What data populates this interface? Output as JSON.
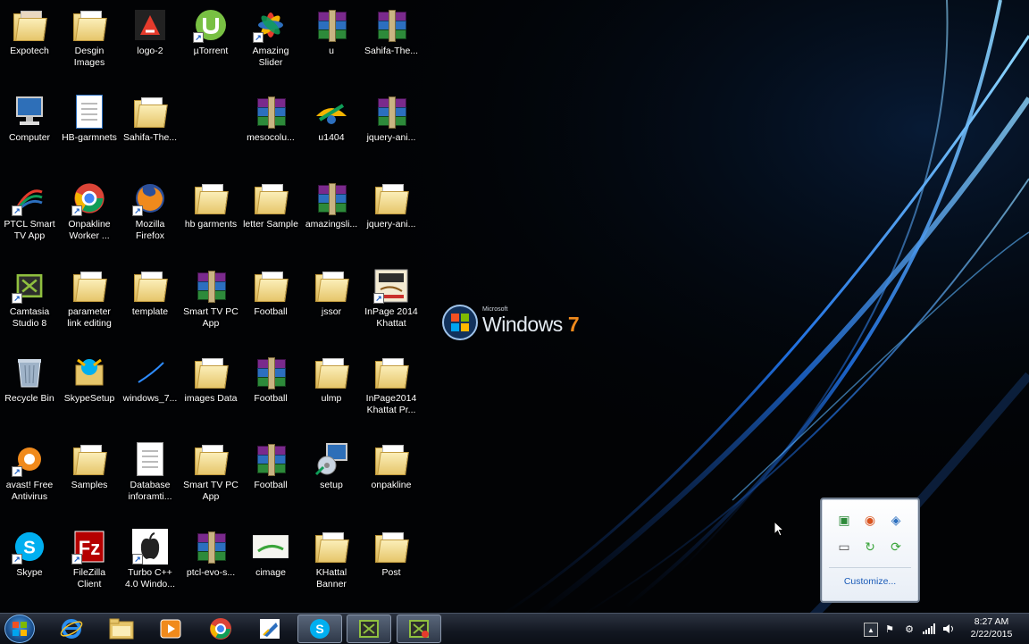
{
  "desktop": {
    "icons": [
      {
        "label": "Expotech"
      },
      {
        "label": "Desgin\nImages"
      },
      {
        "label": "logo-2"
      },
      {
        "label": "µTorrent"
      },
      {
        "label": "Amazing\nSlider"
      },
      {
        "label": "u"
      },
      {
        "label": "Sahifa-The..."
      },
      {
        "label": "Computer"
      },
      {
        "label": "HB-garmnets"
      },
      {
        "label": "Sahifa-The..."
      },
      {
        "label": "mesocolu..."
      },
      {
        "label": "u1404"
      },
      {
        "label": "jquery-ani..."
      },
      {
        "label": "PTCL Smart\nTV App"
      },
      {
        "label": "Onpakline\nWorker ..."
      },
      {
        "label": "Mozilla\nFirefox"
      },
      {
        "label": "hb garments"
      },
      {
        "label": "letter Sample"
      },
      {
        "label": "amazingsli..."
      },
      {
        "label": "jquery-ani..."
      },
      {
        "label": "Camtasia\nStudio 8"
      },
      {
        "label": "parameter\nlink editing"
      },
      {
        "label": "template"
      },
      {
        "label": "Smart TV PC\nApp"
      },
      {
        "label": "Football"
      },
      {
        "label": "jssor"
      },
      {
        "label": "InPage 2014\nKhattat"
      },
      {
        "label": "Recycle Bin"
      },
      {
        "label": "SkypeSetup"
      },
      {
        "label": "windows_7..."
      },
      {
        "label": "images Data"
      },
      {
        "label": "Football"
      },
      {
        "label": "ulmp"
      },
      {
        "label": "InPage2014\nKhattat Pr..."
      },
      {
        "label": "avast! Free\nAntivirus"
      },
      {
        "label": "Samples"
      },
      {
        "label": "Database\ninforamti..."
      },
      {
        "label": "Smart TV PC\nApp"
      },
      {
        "label": "Football"
      },
      {
        "label": "setup"
      },
      {
        "label": "onpakline"
      },
      {
        "label": "Skype"
      },
      {
        "label": "FileZilla\nClient"
      },
      {
        "label": "Turbo C++\n4.0 Windo..."
      },
      {
        "label": "ptcl-evo-s..."
      },
      {
        "label": "cimage"
      },
      {
        "label": "KHattal\nBanner"
      },
      {
        "label": "Post"
      }
    ]
  },
  "wallpaper": {
    "brand_small": "Microsoft",
    "brand": "Windows",
    "version": "7"
  },
  "tray_popup": {
    "customize_label": "Customize..."
  },
  "taskbar": {
    "time": "8:27 AM",
    "date": "2/22/2015"
  },
  "colors": {
    "wallpaper_bg": "#020305",
    "swoosh": "#2e8cff",
    "windows_seven": "#f08a1c",
    "link": "#1a5bb8"
  }
}
